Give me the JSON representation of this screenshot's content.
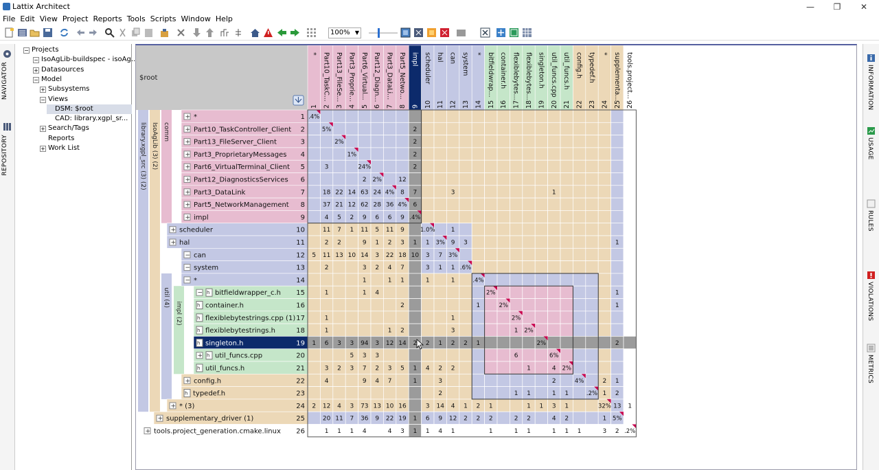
{
  "window": {
    "title": "Lattix Architect",
    "minimize": "—",
    "restore": "❐",
    "close": "✕"
  },
  "menu": [
    "File",
    "Edit",
    "View",
    "Project",
    "Reports",
    "Tools",
    "Scripts",
    "Window",
    "Help"
  ],
  "toolbar": {
    "zoom": "100%"
  },
  "left_tabs": [
    "NAVIGATOR",
    "REPOSITORY"
  ],
  "right_tabs": [
    "INFORMATION",
    "USAGE",
    "RULES",
    "VIOLATIONS",
    "METRICS"
  ],
  "nav_tree": [
    {
      "label": "Projects",
      "depth": 0,
      "icon": "expanded"
    },
    {
      "label": "IsoAgLib-buildspec - isoAg...",
      "depth": 1,
      "icon": "expanded"
    },
    {
      "label": "Datasources",
      "depth": 2,
      "icon": "collapsed"
    },
    {
      "label": "Model",
      "depth": 2,
      "icon": "expanded"
    },
    {
      "label": "Subsystems",
      "depth": 3,
      "icon": "collapsed"
    },
    {
      "label": "Views",
      "depth": 3,
      "icon": "expanded"
    },
    {
      "label": "DSM: $root",
      "depth": 4,
      "icon": "none",
      "selected": true
    },
    {
      "label": "CAD: library.xgpl_sr...",
      "depth": 4,
      "icon": "none"
    },
    {
      "label": "Search/Tags",
      "depth": 3,
      "icon": "collapsed"
    },
    {
      "label": "Reports",
      "depth": 3,
      "icon": "none"
    },
    {
      "label": "Work List",
      "depth": 3,
      "icon": "collapsed"
    }
  ],
  "matrix": {
    "root_label": "$root",
    "groups": [
      "library.xgpl_src (3) (2)",
      "IsoAgLib (3) (2)",
      "comm",
      "util (4)",
      "impl (2)"
    ],
    "rows": [
      {
        "n": 1,
        "label": "*",
        "short": "*",
        "diag": ".4%",
        "cells": {}
      },
      {
        "n": 2,
        "label": "Part10_TaskController_Client",
        "short": "Part10_TaskC...",
        "diag": "5%",
        "cells": {
          "9": "2"
        }
      },
      {
        "n": 3,
        "label": "Part13_FileServer_Client",
        "short": "Part13_FileSe...",
        "diag": "2%",
        "cells": {
          "9": "2"
        }
      },
      {
        "n": 4,
        "label": "Part3_ProprietaryMessages",
        "short": "Part3_Proprie...",
        "diag": "1%",
        "cells": {
          "9": "2"
        }
      },
      {
        "n": 5,
        "label": "Part6_VirtualTerminal_Client",
        "short": "Part6_Virtual...",
        "diag": "24%",
        "cells": {
          "2": "3",
          "9": "2"
        }
      },
      {
        "n": 6,
        "label": "Part12_DiagnosticsServices",
        "short": "Part12_Diagn...",
        "diag": "2%",
        "cells": {
          "5": "2",
          "8": "12"
        }
      },
      {
        "n": 7,
        "label": "Part3_DataLink",
        "short": "Part3_DataLi...",
        "diag": "4%",
        "cells": {
          "2": "18",
          "3": "22",
          "4": "14",
          "5": "63",
          "6": "24",
          "8": "8",
          "9": "7",
          "12": "3",
          "20": "1"
        }
      },
      {
        "n": 8,
        "label": "Part5_NetworkManagement",
        "short": "Part5_Netwo...",
        "diag": "4%",
        "cells": {
          "2": "37",
          "3": "21",
          "4": "12",
          "5": "62",
          "6": "28",
          "7": "36",
          "9": "6"
        }
      },
      {
        "n": 9,
        "label": "impl",
        "short": "impl",
        "diag": ".4%",
        "cells": {
          "2": "4",
          "3": "5",
          "4": "2",
          "5": "9",
          "6": "6",
          "7": "6",
          "8": "9"
        }
      },
      {
        "n": 10,
        "label": "scheduler",
        "short": "scheduler",
        "diag": "1.0%",
        "cells": {
          "2": "11",
          "3": "7",
          "4": "1",
          "5": "11",
          "6": "5",
          "7": "11",
          "8": "9",
          "12": "1"
        }
      },
      {
        "n": 11,
        "label": "hal",
        "short": "hal",
        "diag": "3%",
        "cells": {
          "2": "2",
          "3": "2",
          "5": "9",
          "6": "1",
          "7": "2",
          "8": "3",
          "9": "1",
          "10": "1",
          "12": "9",
          "13": "3",
          "25": "1"
        }
      },
      {
        "n": 12,
        "label": "can",
        "short": "can",
        "diag": "3%",
        "cells": {
          "1": "5",
          "2": "11",
          "3": "13",
          "4": "10",
          "5": "14",
          "6": "3",
          "7": "22",
          "8": "18",
          "9": "10",
          "10": "3",
          "11": "7"
        }
      },
      {
        "n": 13,
        "label": "system",
        "short": "system",
        "diag": ".6%",
        "cells": {
          "2": "2",
          "5": "3",
          "6": "2",
          "7": "4",
          "8": "7",
          "10": "3",
          "11": "1",
          "12": "1"
        }
      },
      {
        "n": 14,
        "label": "*",
        "short": "*",
        "diag": ".4%",
        "cells": {
          "5": "1",
          "7": "1",
          "8": "1",
          "10": "1",
          "12": "1"
        }
      },
      {
        "n": 15,
        "label": "bitfieldwrapper_c.h",
        "short": "bitfieldwrap...",
        "diag": "2%",
        "cells": {
          "2": "1",
          "5": "1",
          "6": "4",
          "25": "1"
        }
      },
      {
        "n": 16,
        "label": "container.h",
        "short": "container.h",
        "diag": "2%",
        "cells": {
          "8": "2",
          "14": "1",
          "25": "1"
        }
      },
      {
        "n": 17,
        "label": "flexiblebytestrings.cpp (1)",
        "short": "flexiblebytes...",
        "diag": "2%",
        "cells": {
          "2": "1",
          "12": "1"
        }
      },
      {
        "n": 18,
        "label": "flexiblebytestrings.h",
        "short": "flexiblebytes...",
        "diag": "2%",
        "cells": {
          "2": "1",
          "7": "1",
          "8": "2",
          "12": "3",
          "17": "1"
        }
      },
      {
        "n": 19,
        "label": "singleton.h",
        "short": "singleton.h",
        "diag": "2%",
        "cells": {
          "1": "1",
          "2": "6",
          "3": "3",
          "4": "3",
          "5": "94",
          "6": "3",
          "7": "12",
          "8": "14",
          "9": "2",
          "10": "2",
          "11": "1",
          "12": "2",
          "13": "2",
          "14": "1",
          "25": "2"
        }
      },
      {
        "n": 20,
        "label": "util_funcs.cpp",
        "short": "util_funcs.cpp",
        "diag": "6%",
        "cells": {
          "4": "5",
          "5": "3",
          "6": "3",
          "17": "6"
        }
      },
      {
        "n": 21,
        "label": "util_funcs.h",
        "short": "util_funcs.h",
        "diag": "2%",
        "cells": {
          "2": "3",
          "3": "2",
          "4": "3",
          "5": "7",
          "6": "2",
          "7": "3",
          "8": "5",
          "9": "1",
          "10": "4",
          "11": "2",
          "12": "2",
          "18": "1",
          "20": "4"
        }
      },
      {
        "n": 22,
        "label": "config.h",
        "short": "config.h",
        "diag": "4%",
        "cells": {
          "2": "4",
          "5": "9",
          "6": "4",
          "7": "7",
          "9": "1",
          "11": "3",
          "20": "2",
          "24": "2",
          "25": "1"
        }
      },
      {
        "n": 23,
        "label": "typedef.h",
        "short": "typedef.h",
        "diag": ".2%",
        "cells": {
          "11": "2",
          "17": "1",
          "18": "1",
          "20": "1",
          "21": "1",
          "24": "1",
          "25": "2"
        }
      },
      {
        "n": 24,
        "label": "* (3)",
        "short": "*",
        "diag": "32%",
        "cells": {
          "1": "2",
          "2": "12",
          "3": "4",
          "4": "3",
          "5": "73",
          "6": "13",
          "7": "10",
          "8": "16",
          "10": "3",
          "11": "14",
          "12": "4",
          "13": "1",
          "14": "2",
          "15": "1",
          "18": "1",
          "19": "1",
          "20": "3",
          "21": "1",
          "25": "13",
          "26": "1"
        }
      },
      {
        "n": 25,
        "label": "supplementary_driver (1)",
        "short": "supplementa...",
        "diag": "5%",
        "cells": {
          "2": "20",
          "3": "11",
          "4": "7",
          "5": "36",
          "6": "9",
          "7": "22",
          "8": "19",
          "9": "1",
          "10": "6",
          "11": "9",
          "12": "12",
          "13": "2",
          "14": "2",
          "15": "2",
          "17": "2",
          "18": "2",
          "20": "4",
          "21": "2",
          "24": "1"
        }
      },
      {
        "n": 26,
        "label": "tools.project_generation.cmake.linux",
        "short": "tools.project...",
        "diag": ".2%",
        "cells": {
          "2": "1",
          "3": "1",
          "4": "1",
          "5": "4",
          "7": "4",
          "8": "3",
          "9": "1",
          "10": "1",
          "11": "4",
          "12": "1",
          "15": "1",
          "17": "1",
          "18": "1",
          "20": "1",
          "21": "1",
          "22": "1",
          "24": "3",
          "25": "2"
        }
      }
    ]
  },
  "colors": {
    "pink": "#e7bcd0",
    "blue": "#c3c8e4",
    "tan": "#ecd8b7",
    "green": "#c5e6c9",
    "selected": "#0c2a6b",
    "marker": "#c8004d"
  }
}
